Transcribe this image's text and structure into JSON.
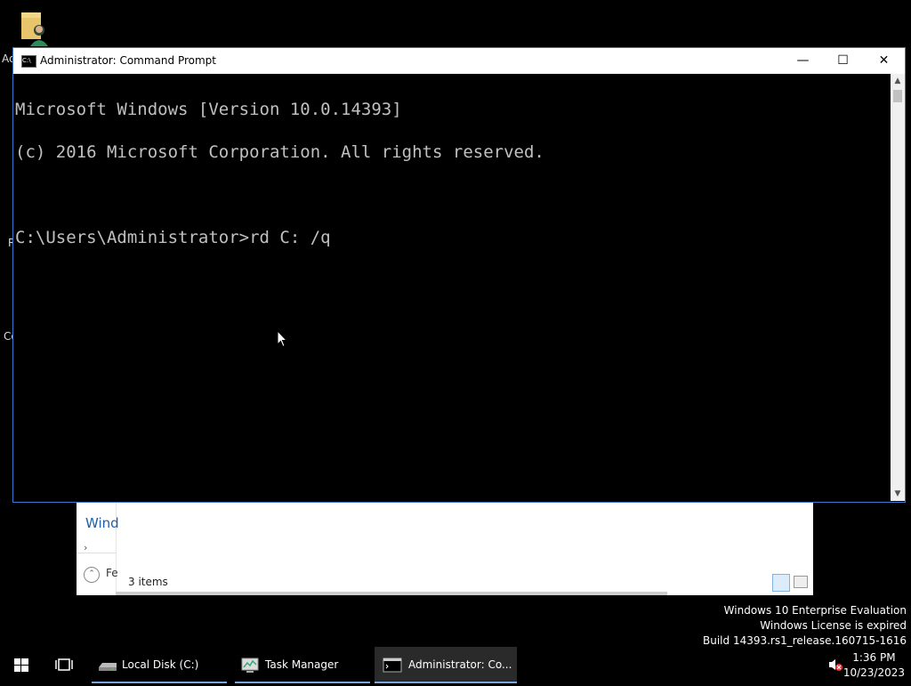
{
  "desktop": {
    "labels": [
      "Ac",
      "R",
      "Co"
    ]
  },
  "explorer": {
    "nav_text": "Wind",
    "footer_text": "Fe",
    "status": "3 items"
  },
  "cmd": {
    "title": "Administrator: Command Prompt",
    "icon_text": "C:\\",
    "minimize": "—",
    "maximize": "☐",
    "close": "✕",
    "lines": [
      "Microsoft Windows [Version 10.0.14393]",
      "(c) 2016 Microsoft Corporation. All rights reserved.",
      "",
      "C:\\Users\\Administrator>rd C: /q"
    ]
  },
  "watermark": {
    "line1": "Windows 10 Enterprise Evaluation",
    "line2": "Windows License is expired",
    "line3": "Build 14393.rs1_release.160715-1616"
  },
  "taskbar": {
    "apps": [
      {
        "label": "Local Disk (C:)"
      },
      {
        "label": "Task Manager"
      },
      {
        "label": "Administrator: Co..."
      }
    ],
    "time": "1:36 PM",
    "date": "10/23/2023"
  }
}
